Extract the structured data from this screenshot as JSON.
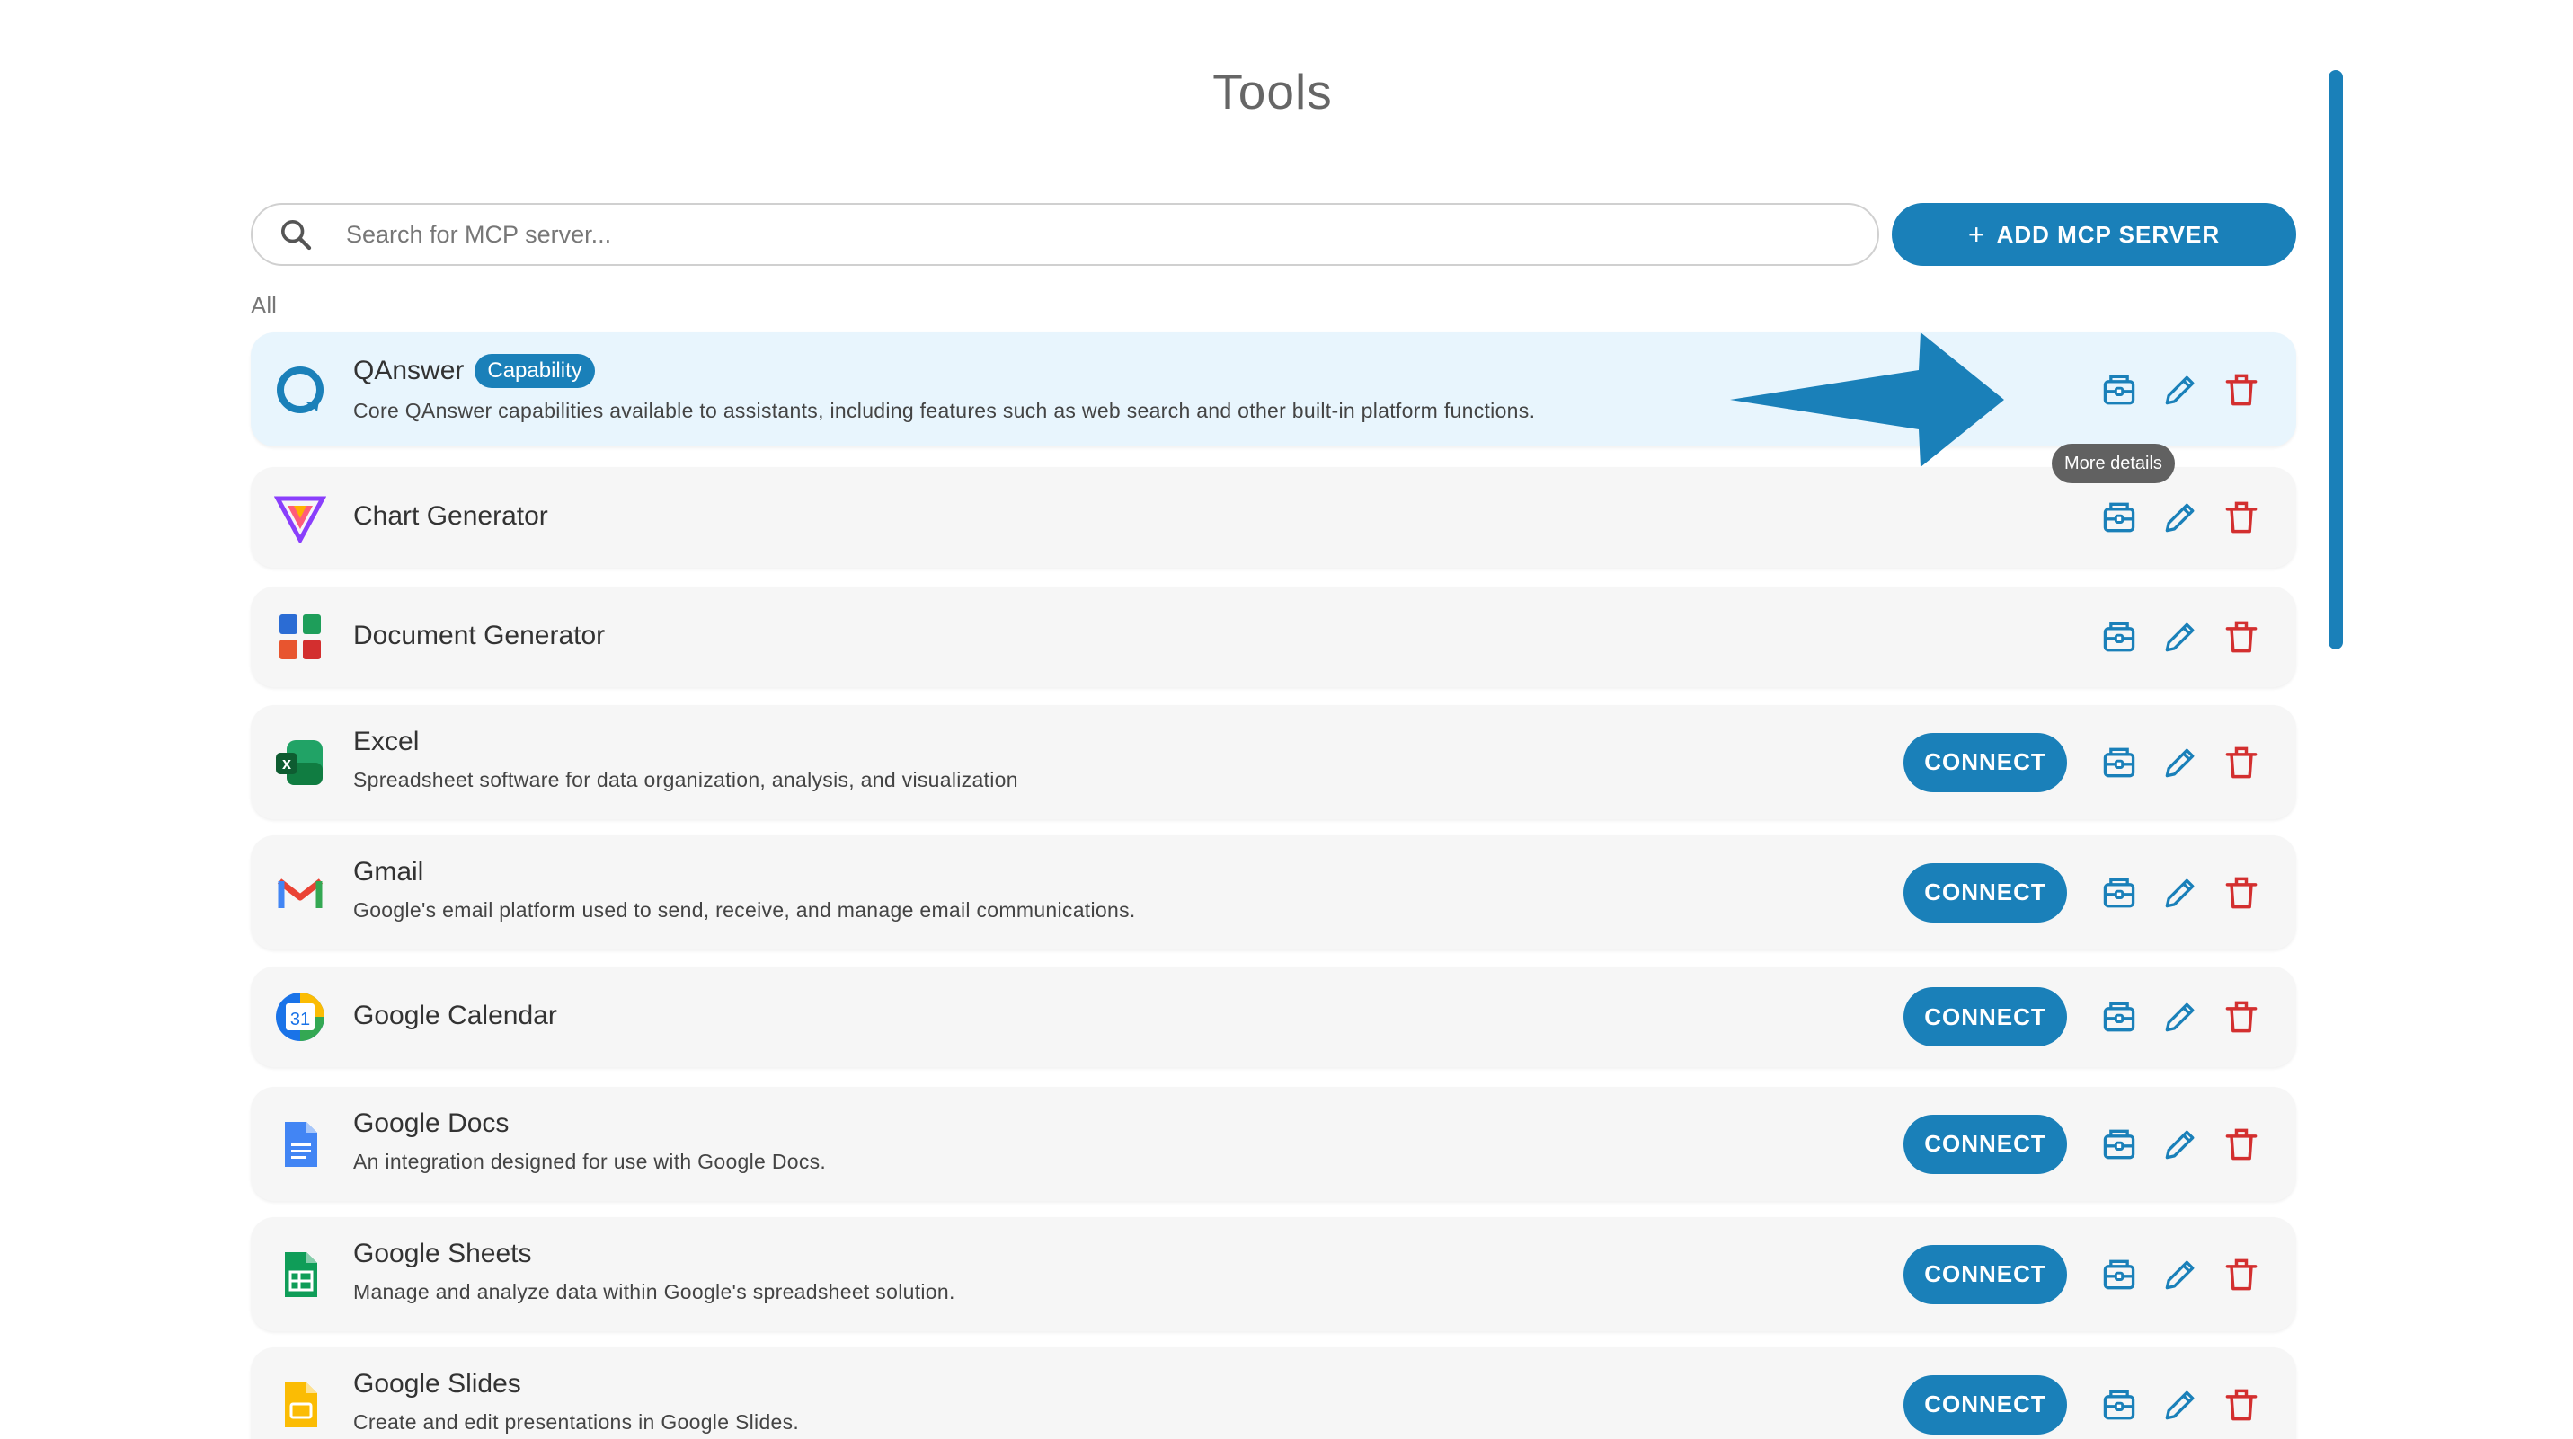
{
  "page": {
    "title": "Tools"
  },
  "search": {
    "placeholder": "Search for MCP server..."
  },
  "add_button": {
    "label": "ADD MCP SERVER"
  },
  "filter": {
    "label": "All"
  },
  "tooltip": {
    "text": "More details"
  },
  "colors": {
    "accent": "#1a80b9",
    "danger": "#d32f2f",
    "selected_row": "#e8f5fd",
    "row": "#f6f6f6"
  },
  "tools": [
    {
      "name": "QAnswer",
      "badge": "Capability",
      "description": "Core QAnswer capabilities available to assistants, including features such as web search and other built-in platform functions.",
      "connect": "",
      "icon": "qanswer-logo-icon"
    },
    {
      "name": "Chart Generator",
      "badge": "",
      "description": "",
      "connect": "",
      "icon": "chart-generator-logo-icon"
    },
    {
      "name": "Document Generator",
      "badge": "",
      "description": "",
      "connect": "",
      "icon": "document-generator-logo-icon"
    },
    {
      "name": "Excel",
      "badge": "",
      "description": "Spreadsheet software for data organization, analysis, and visualization",
      "connect": "CONNECT",
      "icon": "excel-logo-icon"
    },
    {
      "name": "Gmail",
      "badge": "",
      "description": "Google's email platform used to send, receive, and manage email communications.",
      "connect": "CONNECT",
      "icon": "gmail-logo-icon"
    },
    {
      "name": "Google Calendar",
      "badge": "",
      "description": "",
      "connect": "CONNECT",
      "icon": "google-calendar-logo-icon",
      "icon_text": "31"
    },
    {
      "name": "Google Docs",
      "badge": "",
      "description": "An integration designed for use with Google Docs.",
      "connect": "CONNECT",
      "icon": "google-docs-logo-icon"
    },
    {
      "name": "Google Sheets",
      "badge": "",
      "description": "Manage and analyze data within Google's spreadsheet solution.",
      "connect": "CONNECT",
      "icon": "google-sheets-logo-icon"
    },
    {
      "name": "Google Slides",
      "badge": "",
      "description": "Create and edit presentations in Google Slides.",
      "connect": "CONNECT",
      "icon": "google-slides-logo-icon"
    }
  ]
}
